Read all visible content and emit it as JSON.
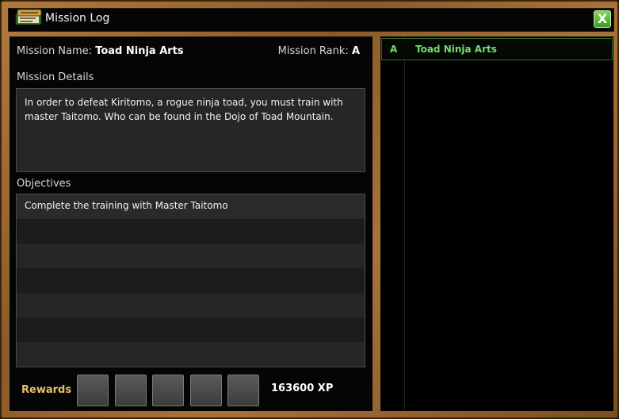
{
  "window": {
    "title": "Mission Log",
    "close_label": "X"
  },
  "mission": {
    "name_label": "Mission Name:",
    "name": "Toad Ninja Arts",
    "rank_label": "Mission Rank:",
    "rank": "A",
    "details_heading": "Mission Details",
    "details": "In order to defeat Kiritomo, a rogue ninja toad, you must train with master Taitomo. Who can be found in the Dojo of Toad Mountain.",
    "objectives_heading": "Objectives",
    "objectives": [
      "Complete the training with Master Taitomo",
      "",
      "",
      "",
      "",
      "",
      ""
    ],
    "rewards_label": "Rewards",
    "reward_slots": 5,
    "xp": "163600 XP"
  },
  "mission_list": [
    {
      "rank": "A",
      "name": "Toad Ninja Arts"
    }
  ],
  "colors": {
    "frame": "#a8733a",
    "accent_green": "#6fe06a",
    "rewards_gold": "#e8c070"
  }
}
